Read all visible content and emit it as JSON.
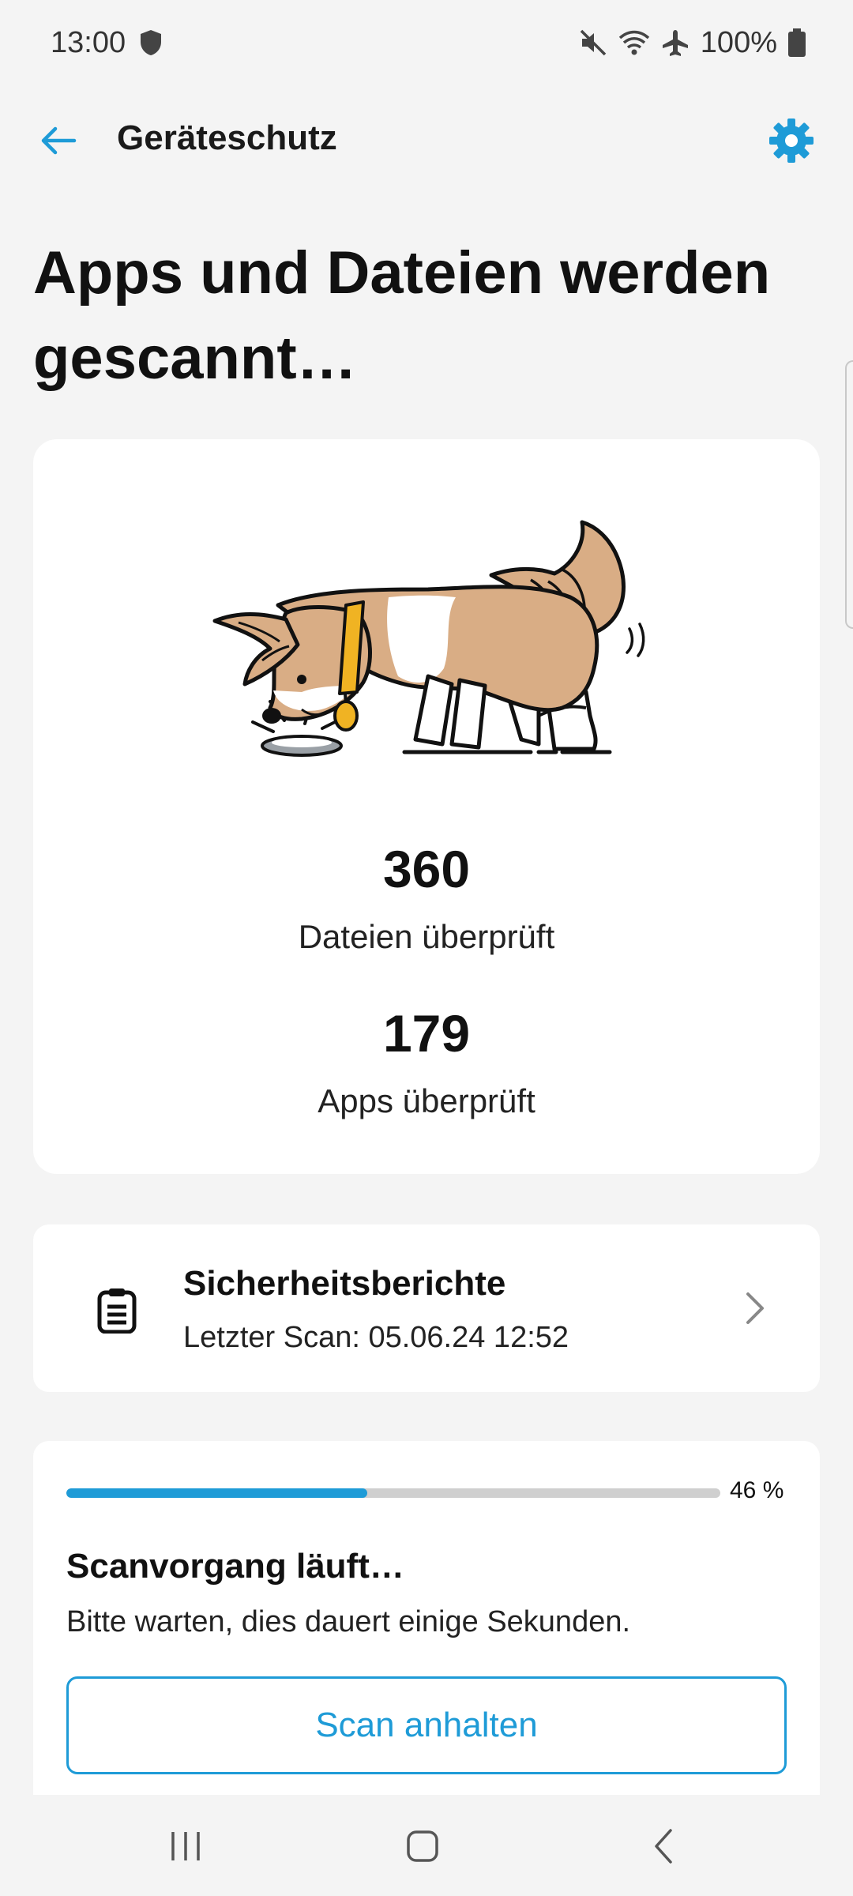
{
  "status_bar": {
    "time": "13:00",
    "battery": "100%",
    "icons": [
      "shield-icon",
      "mute-icon",
      "wifi-icon",
      "airplane-icon",
      "battery-icon"
    ]
  },
  "app_bar": {
    "title": "Geräteschutz",
    "back_icon": "arrow-left-icon",
    "settings_icon": "gear-icon"
  },
  "headline": "Apps und Dateien werden gescannt…",
  "stats": {
    "files_count": "360",
    "files_label": "Dateien überprüft",
    "apps_count": "179",
    "apps_label": "Apps überprüft"
  },
  "report": {
    "title": "Sicherheitsberichte",
    "subtitle": "Letzter Scan: 05.06.24 12:52"
  },
  "scan": {
    "progress_value": 0.46,
    "progress_text": "46 %",
    "title": "Scanvorgang läuft…",
    "subtitle": "Bitte warten, dies dauert einige Sekunden.",
    "stop_label": "Scan anhalten"
  },
  "colors": {
    "accent": "#1e9bd7",
    "background": "#f4f4f4",
    "card": "#ffffff",
    "dog_fur": "#d9ad85",
    "collar": "#f0b323"
  }
}
